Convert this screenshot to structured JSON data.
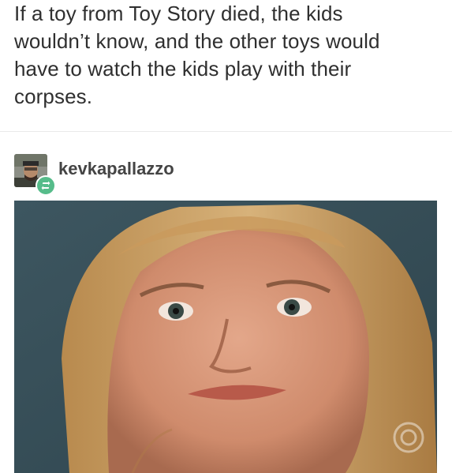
{
  "post": {
    "text_lines": [
      "If a toy from Toy Story died, the kids",
      "wouldn’t know, and the other toys would",
      "have to watch the kids play with their",
      "corpses."
    ]
  },
  "reblog": {
    "username": "kevkapallazzo",
    "avatar_icon": "user-avatar",
    "badge_icon": "reblog-icon",
    "badge_color": "#56bc8a"
  },
  "image": {
    "icon": "broadcast-logo-icon",
    "subject": "photo"
  }
}
